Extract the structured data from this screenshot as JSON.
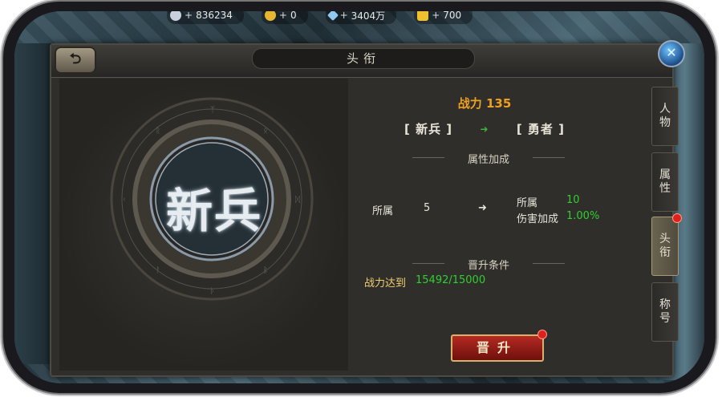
{
  "resources": [
    {
      "icon": "silver-coin-icon",
      "value": "836234"
    },
    {
      "icon": "gold-coin-icon",
      "value": "0"
    },
    {
      "icon": "diamond-icon",
      "value": "3404万"
    },
    {
      "icon": "gold-ingot-icon",
      "value": "700"
    }
  ],
  "panel": {
    "title": "头衔",
    "back_icon": "back-arrow-icon",
    "close_icon": "close-icon"
  },
  "emblem": {
    "rank_name": "新兵"
  },
  "detail": {
    "power_label": "战力 135",
    "current_rank": "[ 新兵 ]",
    "next_rank": "[ 勇者 ]",
    "attr_header": "属性加成",
    "attr_current_label": "所属",
    "attr_current_value": "5",
    "attr_next_label1": "所属",
    "attr_next_value1": "10",
    "attr_next_label2": "伤害加成",
    "attr_next_value2": "1.00%",
    "cond_header": "晋升条件",
    "cond_label": "战力达到",
    "cond_value": "15492/15000",
    "button": "晋升"
  },
  "tabs": [
    "人物",
    "属性",
    "头衔",
    "称号"
  ],
  "colors": {
    "power": "#f0a020",
    "value_green": "#2fd02f",
    "button": "#b52a22"
  }
}
